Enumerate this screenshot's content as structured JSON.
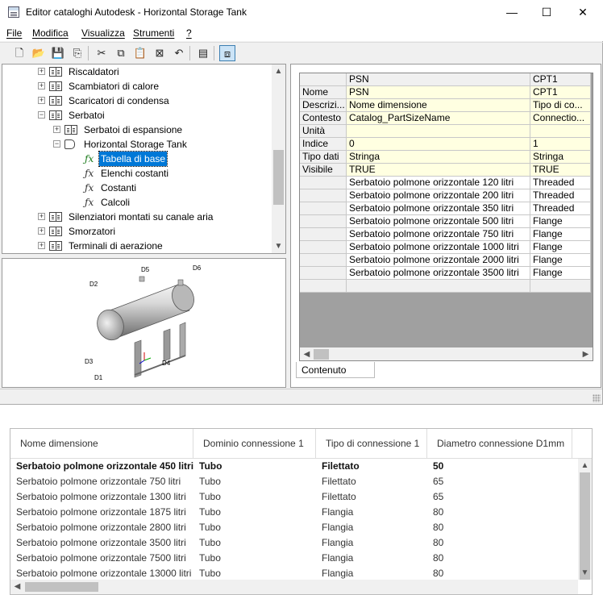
{
  "window": {
    "title": "Editor cataloghi Autodesk - Horizontal Storage Tank",
    "controls": {
      "minimize": "—",
      "maximize": "☐",
      "close": "✕"
    }
  },
  "menu": [
    "File",
    "Modifica",
    "Visualizza",
    "Strumenti",
    "?"
  ],
  "toolbar": [
    {
      "icon": "new-file-icon",
      "glyph": "🗋"
    },
    {
      "icon": "open-folder-icon",
      "glyph": "📂"
    },
    {
      "icon": "save-icon",
      "glyph": "💾"
    },
    {
      "icon": "publish-icon",
      "glyph": "⎘"
    },
    {
      "icon": "cut-icon",
      "glyph": "✂"
    },
    {
      "icon": "copy-icon",
      "glyph": "⧉"
    },
    {
      "icon": "paste-icon",
      "glyph": "📋"
    },
    {
      "icon": "delete-icon",
      "glyph": "⊠"
    },
    {
      "icon": "undo-icon",
      "glyph": "↶"
    },
    {
      "icon": "properties-icon",
      "glyph": "▤"
    },
    {
      "icon": "preview-toggle-icon",
      "glyph": "⧈"
    }
  ],
  "tree": {
    "items": [
      {
        "label": "Riscaldatori",
        "level": 1,
        "expander": "+",
        "icon": "book-icon"
      },
      {
        "label": "Scambiatori di calore",
        "level": 1,
        "expander": "+",
        "icon": "book-icon"
      },
      {
        "label": "Scaricatori di condensa",
        "level": 1,
        "expander": "+",
        "icon": "book-icon"
      },
      {
        "label": "Serbatoi",
        "level": 1,
        "expander": "−",
        "icon": "book-icon"
      },
      {
        "label": "Serbatoi di espansione",
        "level": 2,
        "expander": "+",
        "icon": "book-icon"
      },
      {
        "label": "Horizontal Storage Tank",
        "level": 2,
        "expander": "−",
        "icon": "cylinder-icon"
      },
      {
        "label": "Tabella di base",
        "level": 3,
        "expander": "",
        "icon": "fx-icon",
        "selected": true
      },
      {
        "label": "Elenchi costanti",
        "level": 3,
        "expander": "",
        "icon": "fx-icon"
      },
      {
        "label": "Costanti",
        "level": 3,
        "expander": "",
        "icon": "fx-icon"
      },
      {
        "label": "Calcoli",
        "level": 3,
        "expander": "",
        "icon": "fx-icon"
      },
      {
        "label": "Silenziatori montati su canale aria",
        "level": 1,
        "expander": "+",
        "icon": "book-icon"
      },
      {
        "label": "Smorzatori",
        "level": 1,
        "expander": "+",
        "icon": "book-icon"
      },
      {
        "label": "Terminali di aerazione",
        "level": 1,
        "expander": "+",
        "icon": "book-icon"
      }
    ]
  },
  "preview": {
    "labels": [
      "D5",
      "D6",
      "D2",
      "D3",
      "D1",
      "D4"
    ]
  },
  "grid": {
    "columns": [
      "PSN",
      "CPT1"
    ],
    "meta_rows": [
      {
        "header": "Nome",
        "psn": "PSN",
        "cpt1": "CPT1"
      },
      {
        "header": "Descrizi...",
        "psn": "Nome dimensione",
        "cpt1": "Tipo di co..."
      },
      {
        "header": "Contesto",
        "psn": "Catalog_PartSizeName",
        "cpt1": "Connectio..."
      },
      {
        "header": "Unità",
        "psn": "",
        "cpt1": ""
      },
      {
        "header": "Indice",
        "psn": "0",
        "cpt1": "1"
      },
      {
        "header": "Tipo dati",
        "psn": "Stringa",
        "cpt1": "Stringa"
      },
      {
        "header": "Visibile",
        "psn": "TRUE",
        "cpt1": "TRUE"
      }
    ],
    "data_rows": [
      {
        "psn": "Serbatoio polmone orizzontale 120 litri",
        "cpt1": "Threaded"
      },
      {
        "psn": "Serbatoio polmone orizzontale 200 litri",
        "cpt1": "Threaded"
      },
      {
        "psn": "Serbatoio polmone orizzontale 350 litri",
        "cpt1": "Threaded"
      },
      {
        "psn": "Serbatoio polmone orizzontale 500 litri",
        "cpt1": "Flange"
      },
      {
        "psn": "Serbatoio polmone orizzontale 750 litri",
        "cpt1": "Flange"
      },
      {
        "psn": "Serbatoio polmone orizzontale 1000 litri",
        "cpt1": "Flange"
      },
      {
        "psn": "Serbatoio polmone orizzontale 2000 litri",
        "cpt1": "Flange"
      },
      {
        "psn": "Serbatoio polmone orizzontale 3500 litri",
        "cpt1": "Flange"
      },
      {
        "psn": "",
        "cpt1": ""
      }
    ],
    "tab_label": "Contenuto"
  },
  "bottom_table": {
    "headers": [
      "Nome dimensione",
      "Dominio connessione 1",
      "Tipo di connessione 1",
      "Diametro connessione D1mm"
    ],
    "rows": [
      [
        "Serbatoio polmone orizzontale 450 litri",
        "Tubo",
        "Filettato",
        "50"
      ],
      [
        "Serbatoio polmone orizzontale 750 litri",
        "Tubo",
        "Filettato",
        "65"
      ],
      [
        "Serbatoio polmone orizzontale 1300 litri",
        "Tubo",
        "Filettato",
        "65"
      ],
      [
        "Serbatoio polmone orizzontale 1875 litri",
        "Tubo",
        "Flangia",
        "80"
      ],
      [
        "Serbatoio polmone orizzontale 2800 litri",
        "Tubo",
        "Flangia",
        "80"
      ],
      [
        "Serbatoio polmone orizzontale 3500 litri",
        "Tubo",
        "Flangia",
        "80"
      ],
      [
        "Serbatoio polmone orizzontale 7500 litri",
        "Tubo",
        "Flangia",
        "80"
      ],
      [
        "Serbatoio polmone orizzontale 13000 litri",
        "Tubo",
        "Flangia",
        "80"
      ]
    ]
  }
}
